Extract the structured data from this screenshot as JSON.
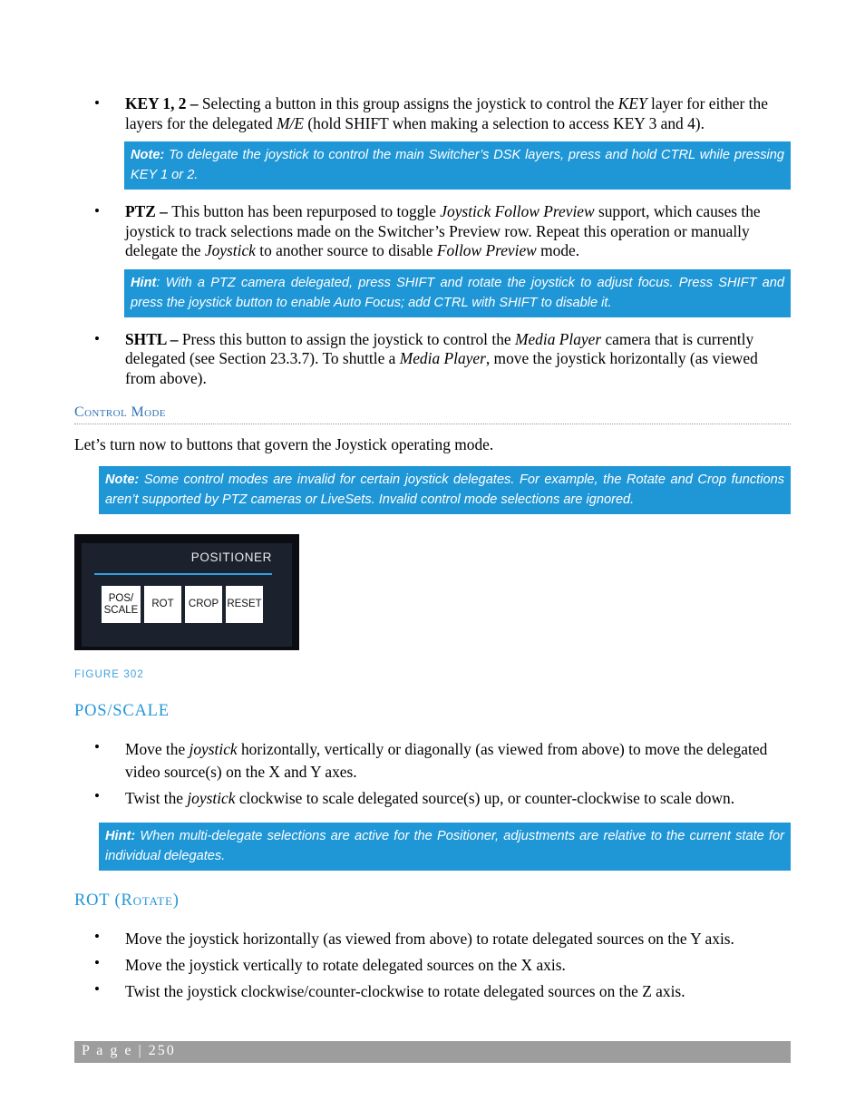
{
  "document": {
    "page_label": "P a g e  |  250"
  },
  "bullets_top": [
    {
      "marker": "•",
      "lead": "KEY 1, 2 – ",
      "segments": [
        {
          "text": "Selecting a button in this group assigns the joystick to control the ",
          "style": "normal"
        },
        {
          "text": "KEY",
          "style": "italic"
        },
        {
          "text": " layer for either the layers for the delegated ",
          "style": "normal"
        },
        {
          "text": "M/E",
          "style": "italic"
        },
        {
          "text": " (hold SHIFT when making a selection to access KEY 3 and 4).",
          "style": "normal"
        }
      ]
    },
    {
      "marker": "•",
      "lead": "PTZ – ",
      "segments": [
        {
          "text": "This button has been repurposed to toggle ",
          "style": "normal"
        },
        {
          "text": "Joystick Follow Preview",
          "style": "italic"
        },
        {
          "text": " support, which causes the joystick to track selections made on the Switcher’s Preview row.  Repeat this operation or manually delegate the ",
          "style": "normal"
        },
        {
          "text": "Joystick",
          "style": "italic"
        },
        {
          "text": " to another source to disable ",
          "style": "normal"
        },
        {
          "text": "Follow Preview",
          "style": "italic"
        },
        {
          "text": " mode.",
          "style": "normal"
        }
      ]
    },
    {
      "marker": "•",
      "lead": "SHTL – ",
      "segments": [
        {
          "text": "Press this button to assign the joystick to control the ",
          "style": "normal"
        },
        {
          "text": "Media Player",
          "style": "italic"
        },
        {
          "text": " camera that is currently delegated (see Section 23.3.7). To shuttle a ",
          "style": "normal"
        },
        {
          "text": "Media Player",
          "style": "italic"
        },
        {
          "text": ", move the joystick horizontally (as viewed from above).",
          "style": "normal"
        }
      ]
    }
  ],
  "callouts": {
    "note_key": {
      "label": "Note:",
      "text": " To delegate the joystick to control the main Switcher’s DSK layers, press and hold CTRL while pressing KEY 1 or 2."
    },
    "hint_ptz": {
      "label": "Hint",
      "text": ": With a PTZ camera delegated, press SHIFT and rotate the joystick to adjust focus. Press SHIFT and press the joystick button to enable Auto Focus; add CTRL with SHIFT to disable it."
    },
    "note_control_mode": {
      "label": "Note:",
      "text": " Some control modes are invalid for certain joystick delegates.  For example, the Rotate and Crop functions aren’t supported by PTZ cameras or LiveSets. Invalid control mode selections are ignored."
    },
    "hint_positioner": {
      "label": "Hint:",
      "text": " When multi-delegate selections are active for the Positioner, adjustments are relative to the current state for individual delegates."
    }
  },
  "sections": {
    "control_mode": {
      "heading": "Control Mode",
      "intro": "Let’s turn now to buttons that govern the Joystick operating mode."
    },
    "pos_scale": {
      "heading": "POS/SCALE",
      "bullets": [
        {
          "marker": "•",
          "segments": [
            {
              "text": "Move the ",
              "style": "normal"
            },
            {
              "text": "joystick",
              "style": "italic"
            },
            {
              "text": " horizontally, vertically or diagonally (as viewed from above) to move the delegated video source(s) on the X and Y axes.",
              "style": "normal"
            }
          ]
        },
        {
          "marker": "•",
          "segments": [
            {
              "text": "Twist the ",
              "style": "normal"
            },
            {
              "text": "joystick",
              "style": "italic"
            },
            {
              "text": " clockwise to scale delegated source(s) up, or counter-clockwise to scale down.",
              "style": "normal"
            }
          ]
        }
      ]
    },
    "rot": {
      "heading_main": "ROT (",
      "heading_small_caps": "Rotate",
      "heading_tail": ")",
      "bullets": [
        {
          "marker": "•",
          "segments": [
            {
              "text": "Move the joystick horizontally (as viewed from above) to rotate delegated sources on the Y axis.",
              "style": "normal"
            }
          ]
        },
        {
          "marker": "•",
          "segments": [
            {
              "text": " Move the joystick vertically to rotate delegated sources on the X axis.",
              "style": "normal"
            }
          ]
        },
        {
          "marker": "•",
          "segments": [
            {
              "text": "Twist the joystick clockwise/counter-clockwise to rotate delegated sources on the Z axis.",
              "style": "normal"
            }
          ]
        }
      ]
    }
  },
  "figure": {
    "caption": "FIGURE 302",
    "panel_title": "POSITIONER",
    "buttons": [
      {
        "label_line1": "POS/",
        "label_line2": "SCALE",
        "width": "wide"
      },
      {
        "label_line1": "ROT",
        "label_line2": "",
        "width": "std"
      },
      {
        "label_line1": "CROP",
        "label_line2": "",
        "width": "std"
      },
      {
        "label_line1": "RESET",
        "label_line2": "",
        "width": "std"
      }
    ]
  },
  "colors": {
    "accent_blue": "#1f96d6",
    "heading_blue": "#2496d8",
    "section_blue": "#2e74b5",
    "panel_dark": "#1b222e",
    "panel_border": "#0b0d12",
    "footer_gray": "#9d9d9d"
  }
}
